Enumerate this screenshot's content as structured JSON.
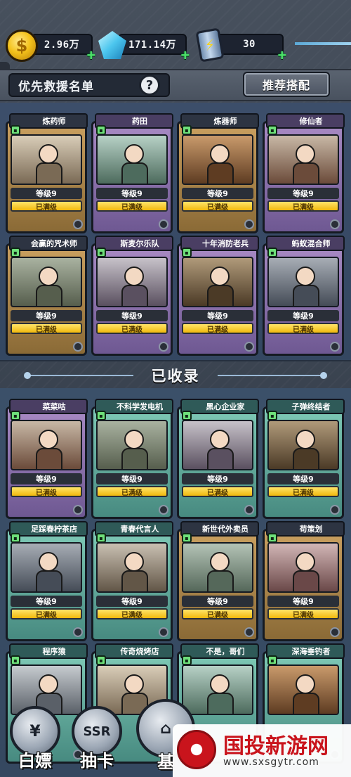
{
  "resources": {
    "gold": "2.96万",
    "gems": "171.14万",
    "energy": "30",
    "gold_icon": "coin-icon",
    "gem_icon": "diamond-icon",
    "energy_icon": "energy-can-icon",
    "plus": "+"
  },
  "header": {
    "title": "优先救援名单",
    "help": "?",
    "recommend": "推荐搭配"
  },
  "priority_cards": [
    {
      "name": "炼药师",
      "level": "等级9",
      "status": "已满级",
      "frame": "gold"
    },
    {
      "name": "药田",
      "level": "等级9",
      "status": "已满级",
      "frame": "purple"
    },
    {
      "name": "炼器师",
      "level": "等级9",
      "status": "已满级",
      "frame": "gold"
    },
    {
      "name": "修仙者",
      "level": "等级9",
      "status": "已满级",
      "frame": "purple"
    },
    {
      "name": "会赢的咒术师",
      "level": "等级9",
      "status": "已满级",
      "frame": "gold"
    },
    {
      "name": "斯麦尔乐队",
      "level": "等级9",
      "status": "已满级",
      "frame": "purple"
    },
    {
      "name": "十年消防老兵",
      "level": "等级9",
      "status": "已满级",
      "frame": "purple"
    },
    {
      "name": "蚂蚁混合师",
      "level": "等级9",
      "status": "已满级",
      "frame": "purple"
    }
  ],
  "collected_title": "已收录",
  "collected_cards": [
    {
      "name": "菜菜咕",
      "level": "等级9",
      "status": "已满级",
      "frame": "purple"
    },
    {
      "name": "不科学发电机",
      "level": "等级9",
      "status": "已满级",
      "frame": "teal"
    },
    {
      "name": "黑心企业家",
      "level": "等级9",
      "status": "已满级",
      "frame": "teal"
    },
    {
      "name": "子弹终结者",
      "level": "等级9",
      "status": "已满级",
      "frame": "teal"
    },
    {
      "name": "足踩春柠茶店",
      "level": "等级9",
      "status": "已满级",
      "frame": "teal"
    },
    {
      "name": "青春代言人",
      "level": "等级9",
      "status": "已满级",
      "frame": "teal"
    },
    {
      "name": "新世代外卖员",
      "level": "等级9",
      "status": "已满级",
      "frame": "gold"
    },
    {
      "name": "苟策划",
      "level": "等级9",
      "status": "已满级",
      "frame": "gold"
    },
    {
      "name": "程序猿",
      "level": "",
      "status": "",
      "frame": "teal"
    },
    {
      "name": "传奇烧烤店",
      "level": "",
      "status": "",
      "frame": "teal"
    },
    {
      "name": "不是，哥们",
      "level": "",
      "status": "",
      "frame": "teal"
    },
    {
      "name": "深海垂钓者",
      "level": "",
      "status": "",
      "frame": "teal"
    }
  ],
  "nav": {
    "freebie": "白嫖",
    "draw": "抽卡",
    "base": "基",
    "ssr": "SSR"
  },
  "watermark": {
    "title": "国投新游网",
    "url": "www.sxsgytr.com"
  }
}
